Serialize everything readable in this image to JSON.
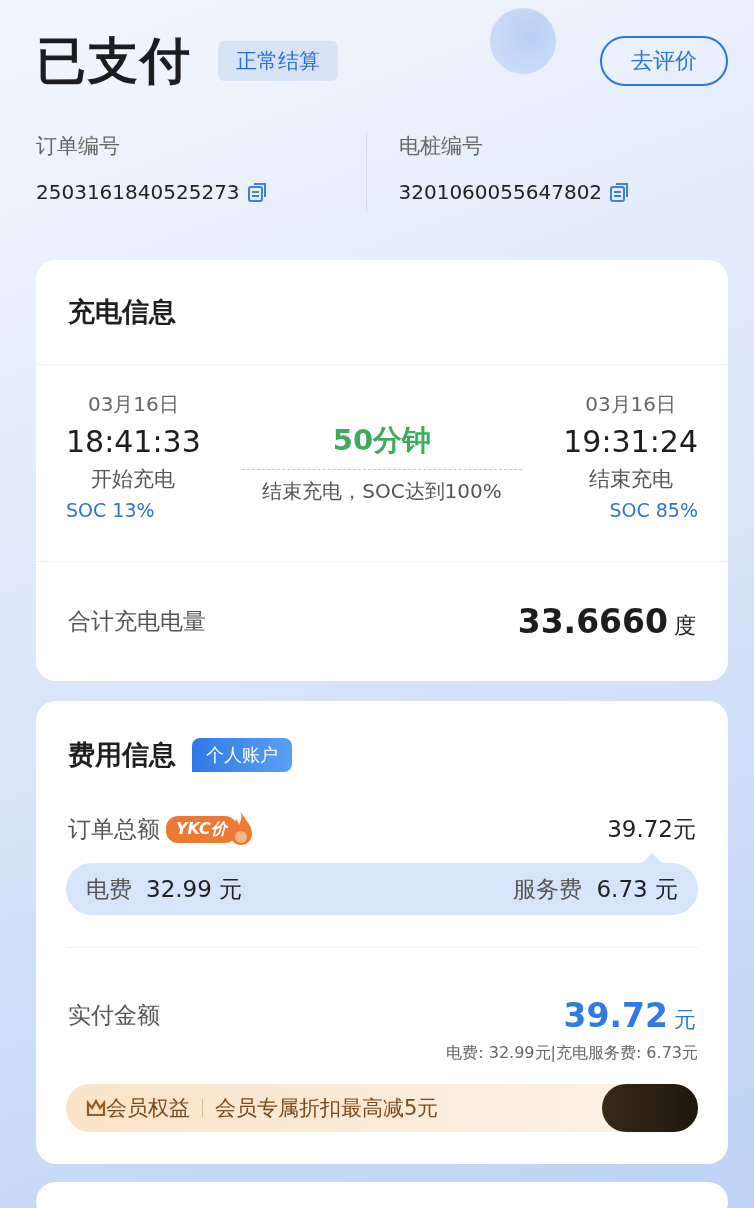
{
  "header": {
    "title": "已支付",
    "status_badge": "正常结算",
    "action_button": "去评价"
  },
  "ids": [
    {
      "label": "订单编号",
      "value": "2503161840525273"
    },
    {
      "label": "电桩编号",
      "value": "3201060055647802"
    }
  ],
  "charging": {
    "title": "充电信息",
    "start": {
      "date": "03月16日",
      "time": "18:41:33",
      "label": "开始充电",
      "soc": "SOC 13%"
    },
    "duration": "50分钟",
    "end_reason": "结束充电，SOC达到100%",
    "end": {
      "date": "03月16日",
      "time": "19:31:24",
      "label": "结束充电",
      "soc": "SOC 85%"
    },
    "total_label": "合计充电电量",
    "total_value": "33.6660",
    "total_unit": "度"
  },
  "fees": {
    "title": "费用信息",
    "account_badge": "个人账户",
    "order_total_label": "订单总额",
    "price_tag": "YKC价",
    "order_total": "39.72元",
    "breakdown": [
      {
        "label": "电费",
        "value": "32.99 元"
      },
      {
        "label": "服务费",
        "value": "6.73 元"
      }
    ],
    "paid_label": "实付金额",
    "paid_value": "39.72",
    "paid_unit": "元",
    "paid_detail": "电费: 32.99元|充电服务费: 6.73元",
    "member": {
      "label": "会员权益",
      "text": "会员专属折扣最高减5元"
    }
  }
}
